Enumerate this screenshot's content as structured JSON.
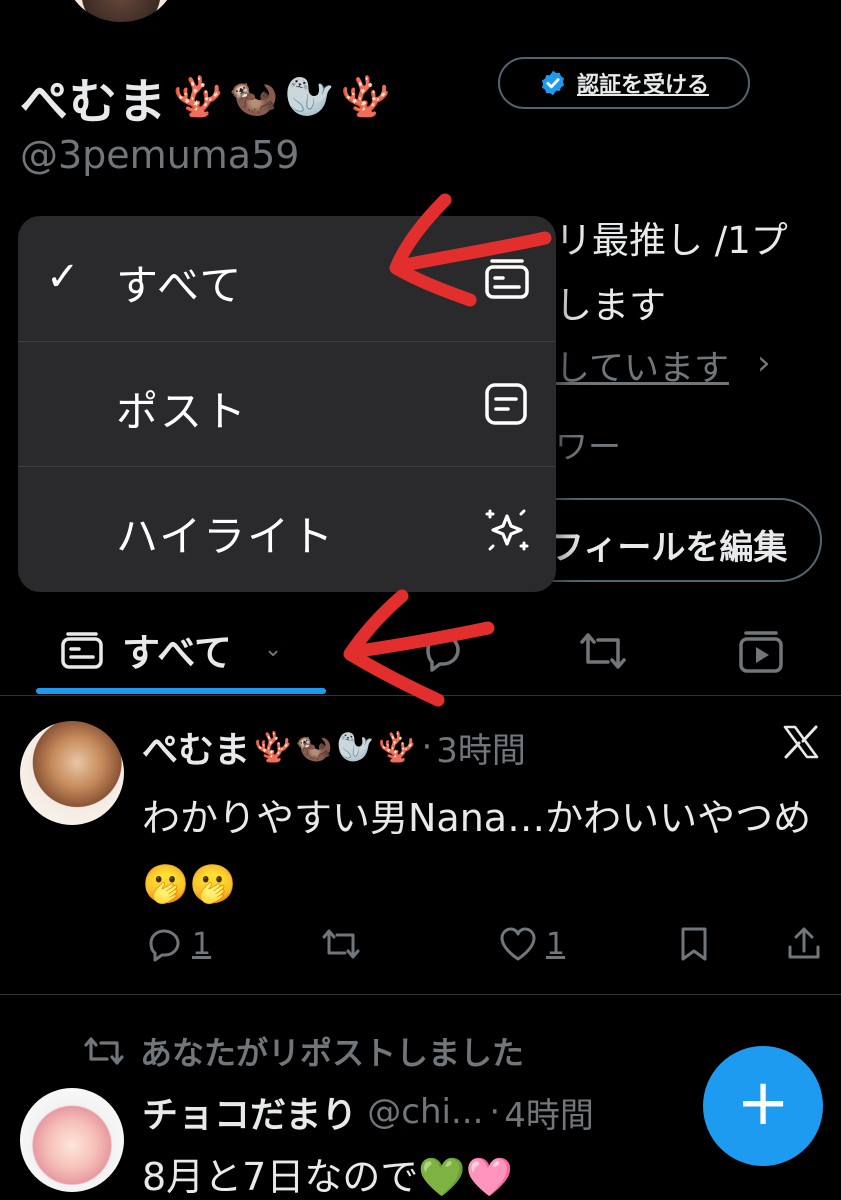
{
  "profile": {
    "display_name": "ぺむま",
    "name_emojis": [
      "🪸",
      "🦦",
      "🦭",
      "🪸"
    ],
    "verify_button_label": "認証を受ける",
    "handle": "@3pemuma59",
    "bio_line1": "リ最推し /1プ",
    "bio_line2": "します",
    "following_text": "しています",
    "follower_text": "ワー",
    "edit_profile_label": "フィールを編集"
  },
  "dropdown": {
    "items": [
      {
        "label": "すべて",
        "checked": true,
        "icon": "all-posts-icon"
      },
      {
        "label": "ポスト",
        "checked": false,
        "icon": "post-icon"
      },
      {
        "label": "ハイライト",
        "checked": false,
        "icon": "sparkle-icon"
      }
    ],
    "check_mark": "✓"
  },
  "tabs": {
    "active_label": "すべて",
    "other_tabs": [
      "reply-icon",
      "repost-icon",
      "media-icon"
    ],
    "accent_color": "#1d9bf0"
  },
  "posts": [
    {
      "name": "ぺむま",
      "emojis": [
        "🪸",
        "🦦",
        "🦭",
        "🪸"
      ],
      "separator": "·",
      "time": "3時間",
      "text": "わかりやすい男Nana…かわいいやつめ🫢🫢",
      "reply_count": "1",
      "like_count": "1"
    },
    {
      "repost_label": "あなたがリポストしました",
      "name": "チョコだまり",
      "handle": "@chi...",
      "separator": "·",
      "time": "4時間",
      "text": "8月と7日なので💚🩷"
    }
  ],
  "compose": {
    "label": "+"
  }
}
